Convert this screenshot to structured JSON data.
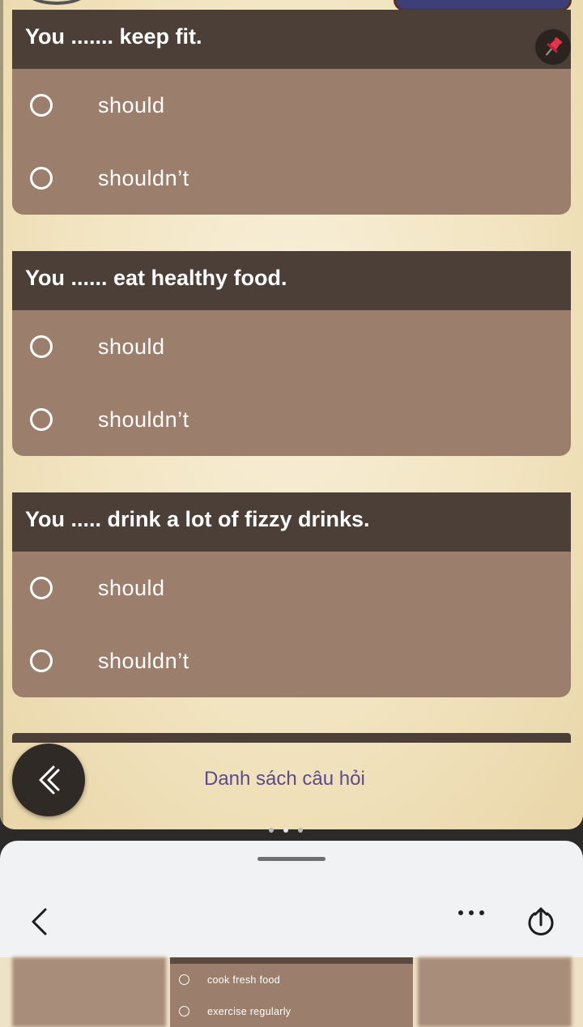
{
  "questions": [
    {
      "prompt": "You ....... keep fit.",
      "options": [
        "should",
        "shouldn’t"
      ]
    },
    {
      "prompt": "You ...... eat healthy food.",
      "options": [
        "should",
        "shouldn’t"
      ]
    },
    {
      "prompt": "You ..... drink a lot of fizzy drinks.",
      "options": [
        "should",
        "shouldn’t"
      ]
    }
  ],
  "bottom": {
    "question_list_label": "Danh sách câu hỏi"
  },
  "preview": {
    "options": [
      "cook fresh food",
      "exercise regularly"
    ]
  },
  "colors": {
    "card_header": "#4c3f37",
    "card_body": "#9b7e6b",
    "link": "#5b4a8e",
    "pin": "#e8344a"
  },
  "icons": {
    "pin": "pushpin-icon",
    "back": "double-chevron-left-icon",
    "share": "share-icon"
  }
}
